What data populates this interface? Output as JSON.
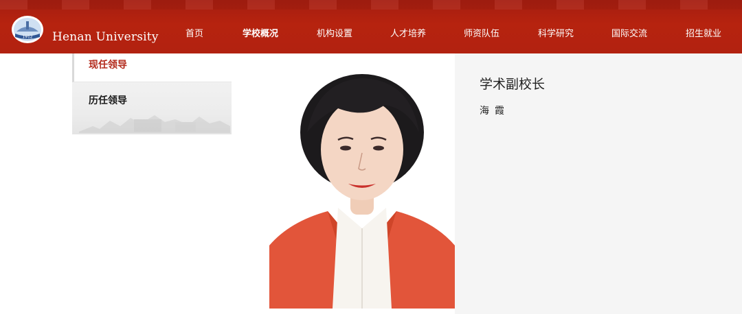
{
  "header": {
    "brand": "Henan University",
    "logo_text": "1912",
    "nav": [
      {
        "label": "首页",
        "active": false
      },
      {
        "label": "学校概况",
        "active": true
      },
      {
        "label": "机构设置",
        "active": false
      },
      {
        "label": "人才培养",
        "active": false
      },
      {
        "label": "师资队伍",
        "active": false
      },
      {
        "label": "科学研究",
        "active": false
      },
      {
        "label": "国际交流",
        "active": false
      },
      {
        "label": "招生就业",
        "active": false
      }
    ],
    "color": "#b22210"
  },
  "sidebar": {
    "items": [
      {
        "label": "现任领导",
        "current": true
      },
      {
        "label": "历任领导",
        "current": false
      }
    ],
    "active_color": "#b32a1c"
  },
  "profile": {
    "position": "学术副校长",
    "name": "海霞"
  }
}
